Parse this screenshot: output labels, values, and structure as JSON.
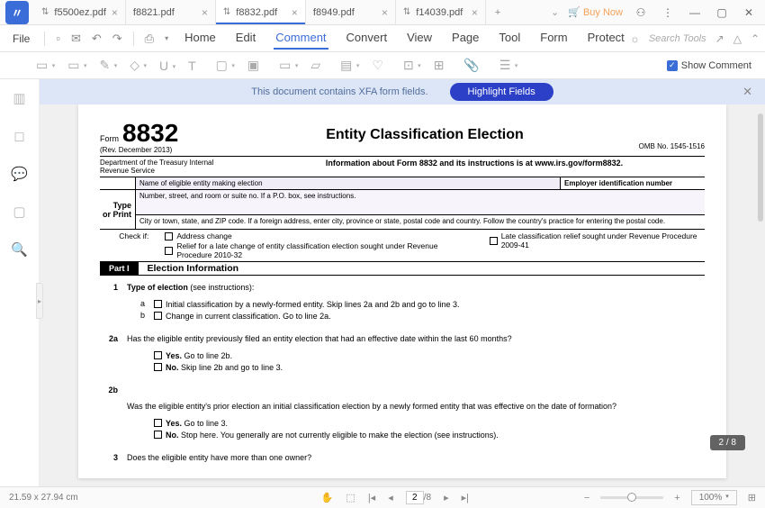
{
  "tabs": {
    "t0": "f5500ez.pdf",
    "t1": "f8821.pdf",
    "t2": "f8832.pdf",
    "t3": "f8949.pdf",
    "t4": "f14039.pdf"
  },
  "titlebar": {
    "buy": "Buy Now"
  },
  "menu": {
    "file": "File",
    "home": "Home",
    "edit": "Edit",
    "comment": "Comment",
    "convert": "Convert",
    "view": "View",
    "page": "Page",
    "tool": "Tool",
    "form": "Form",
    "protect": "Protect",
    "search": "Search Tools"
  },
  "toolbar": {
    "show_comment": "Show Comment"
  },
  "xfa": {
    "msg": "This document contains XFA form fields.",
    "btn": "Highlight Fields"
  },
  "form": {
    "form_label": "Form",
    "form_number": "8832",
    "rev": "(Rev. December 2013)",
    "dept": "Department of the Treasury  Internal Revenue Service",
    "title": "Entity Classification Election",
    "info": "Information about Form 8832 and its instructions is at www.irs.gov/form8832.",
    "omb": "OMB No. 1545-1516",
    "name_label": "Name of eligible entity making election",
    "ein_label": "Employer identification number",
    "type_lbl1": "Type",
    "type_lbl2": "or  Print",
    "addr": "Number, street, and room or suite no. If a P.O. box, see instructions.",
    "city": "City or town, state, and ZIP code. If a foreign address, enter city, province or state, postal code and country. Follow the country's practice for entering the  postal code.",
    "check_if": "Check if:",
    "ci_a": "Address change",
    "ci_b": "Late classification relief sought under Revenue Procedure 2009-41",
    "ci_c": "Relief for a late change of entity classification election sought under Revenue Procedure 2010-32",
    "part1": "Part I",
    "part1_title": "Election Information",
    "q1_num": "1",
    "q1": "Type of election",
    "q1_paren": " (see instructions):",
    "q1a_sub": "a",
    "q1a": "Initial classification by a newly-formed entity. Skip lines 2a and 2b and go to line 3.",
    "q1b_sub": "b",
    "q1b": "Change in current classification. Go to line 2a.",
    "q2a_num": "2a",
    "q2a": "Has the eligible entity previously filed an entity election that had an effective date within the last 60 months?",
    "q2a_yes": " Go to line 2b.",
    "q2a_no": " Skip line 2b and go to line 3.",
    "q2b_num": "2b",
    "q2b": "Was the eligible entity's prior election an initial classification election by a newly formed entity that was effective on the date of formation?",
    "q2b_yes": " Go to line 3.",
    "q2b_no": " Stop here. You generally are not currently eligible to make the election (see instructions).",
    "q3_num": "3",
    "q3": "Does the eligible entity have more than one owner?",
    "yes": "Yes.",
    "no": "No."
  },
  "status": {
    "dims": "21.59 x 27.94 cm",
    "page": "2",
    "total": "/8",
    "indicator": "2 / 8",
    "zoom": "100%"
  }
}
